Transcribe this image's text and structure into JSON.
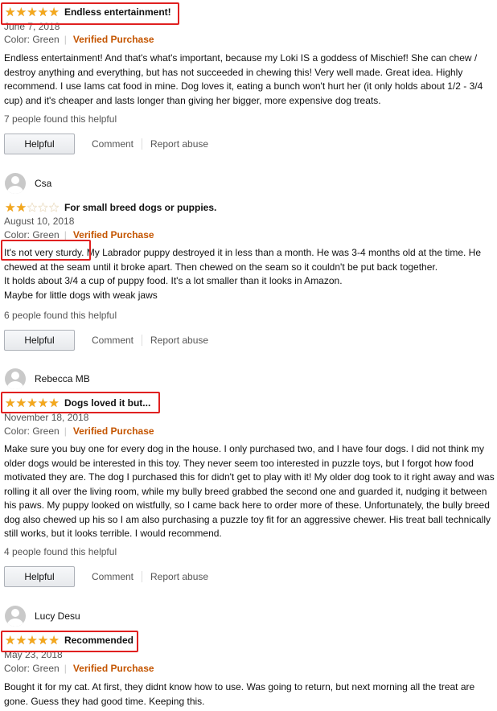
{
  "reviews": [
    {
      "author": "",
      "rating": 5,
      "title": "Endless entertainment!",
      "date": "June 7, 2018",
      "color": "Color: Green",
      "verified": "Verified Purchase",
      "body": [
        "Endless entertainment! And that's what's important, because my Loki IS a goddess of Mischief! She can chew / destroy anything and everything, but has not succeeded in chewing this! Very well made. Great idea. Highly recommend. I use Iams cat food in mine. Dog loves it, eating a bunch won't hurt her (it only holds about 1/2 - 3/4 cup) and it's cheaper and lasts longer than giving her bigger, more expensive dog treats."
      ],
      "helpful_count": "7 people found this helpful",
      "helpful_label": "Helpful",
      "comment_label": "Comment",
      "report_label": "Report abuse"
    },
    {
      "author": "Csa",
      "rating": 2,
      "title": "For small breed dogs or puppies.",
      "date": "August 10, 2018",
      "color": "Color: Green",
      "verified": "Verified Purchase",
      "body": [
        "It's not very sturdy. My Labrador puppy destroyed it in less than a month. He was 3-4 months old at the time. He chewed at the seam until it broke apart. Then chewed on the seam so it couldn't be put back together.",
        "It holds about 3/4 a cup of puppy food. It's a lot smaller than it looks in Amazon.",
        "Maybe for little dogs with weak jaws"
      ],
      "helpful_count": "6 people found this helpful",
      "helpful_label": "Helpful",
      "comment_label": "Comment",
      "report_label": "Report abuse"
    },
    {
      "author": "Rebecca MB",
      "rating": 5,
      "title": "Dogs loved it but...",
      "date": "November 18, 2018",
      "color": "Color: Green",
      "verified": "Verified Purchase",
      "body": [
        "Make sure you buy one for every dog in the house. I only purchased two, and I have four dogs. I did not think my older dogs would be interested in this toy. They never seem too interested in puzzle toys, but I forgot how food motivated they are. The dog I purchased this for didn't get to play with it! My older dog took to it right away and was rolling it all over the living room, while my bully breed grabbed the second one and guarded it, nudging it between his paws. My puppy looked on wistfully, so I came back here to order more of these. Unfortunately, the bully breed dog also chewed up his so I am also purchasing a puzzle toy fit for an aggressive chewer. His treat ball technically still works, but it looks terrible. I would recommend."
      ],
      "helpful_count": "4 people found this helpful",
      "helpful_label": "Helpful",
      "comment_label": "Comment",
      "report_label": "Report abuse"
    },
    {
      "author": "Lucy Desu",
      "rating": 5,
      "title": "Recommended",
      "date": "May 23, 2018",
      "color": "Color: Green",
      "verified": "Verified Purchase",
      "body": [
        "Bought it for my cat. At first, they didnt know how to use. Was going to return, but next morning all the treat are gone. Guess they had good time. Keeping this."
      ],
      "helpful_count": "",
      "helpful_label": "",
      "comment_label": "",
      "report_label": ""
    }
  ],
  "highlight_color": "#e02020",
  "star_color": "#f4a81c",
  "verified_color": "#c45500"
}
